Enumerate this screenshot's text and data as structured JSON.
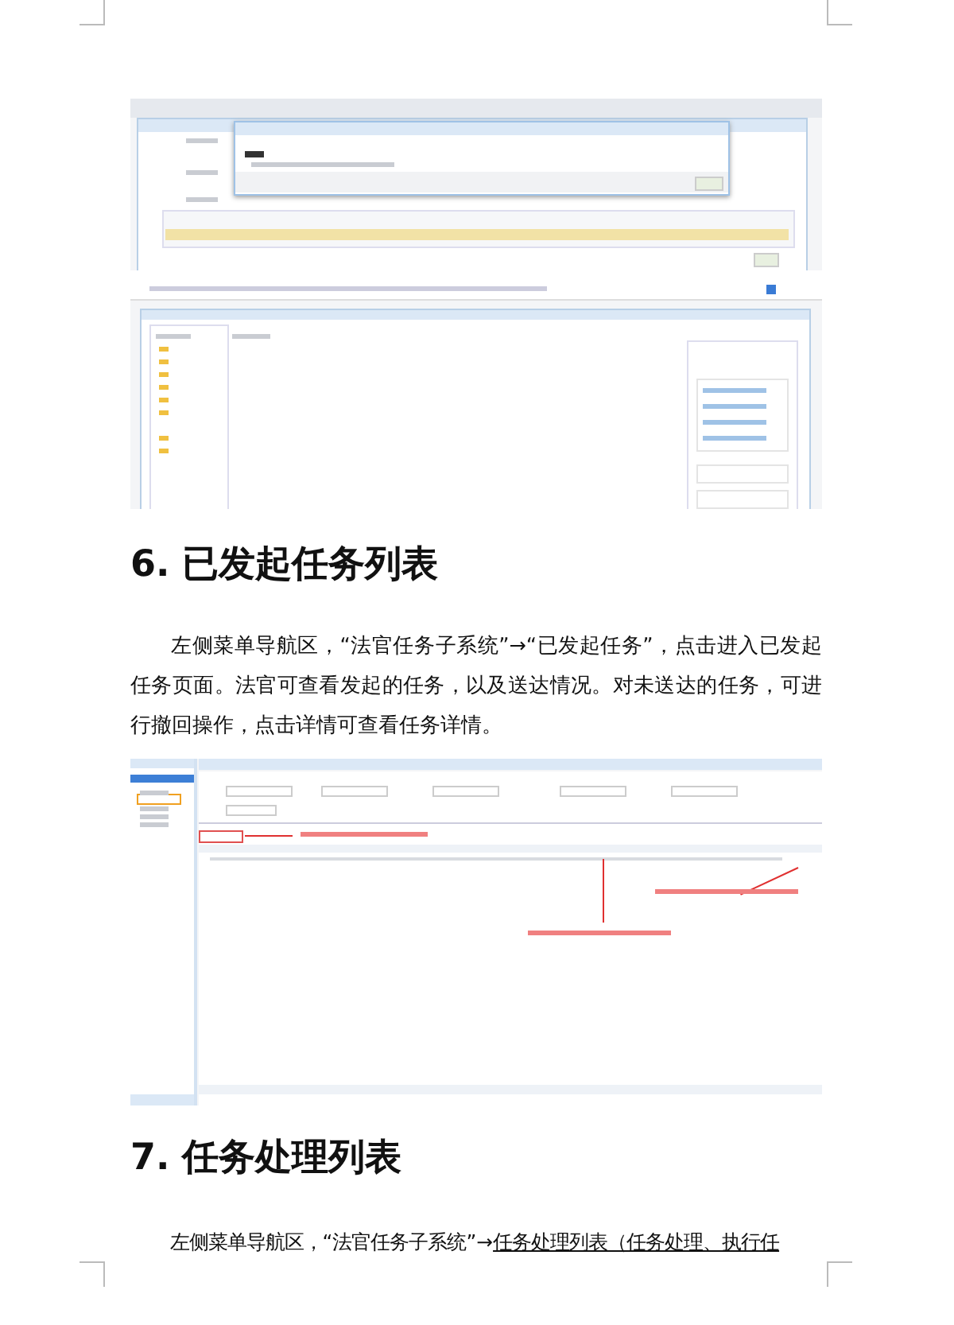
{
  "blocks": [
    {
      "kind": "dialog-shot"
    },
    {
      "kind": "browser-shot"
    },
    {
      "kind": "heading",
      "text": "6.  已发起任务列表"
    },
    {
      "kind": "paragraph",
      "parts": [
        {
          "text": "左侧菜单导航区，“法官任务子系统”→“已发起任务”，点击进入已发起任务页面。法官可查看发起的任务，以及送达情况。对未送达的任务，可进行撤回操作，点击详情可查看任务详情。",
          "underline": false
        }
      ]
    },
    {
      "kind": "list-shot"
    },
    {
      "kind": "heading",
      "text": "7.  任务处理列表"
    },
    {
      "kind": "paragraph",
      "parts": [
        {
          "text": "左侧菜单导航区，“法官任务子系统”→",
          "underline": false
        },
        {
          "text": "任务处理列表（任务处理、执行任",
          "underline": true
        }
      ]
    }
  ]
}
